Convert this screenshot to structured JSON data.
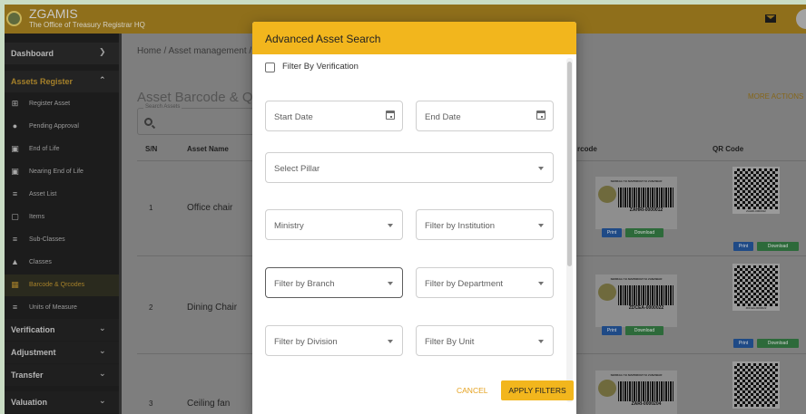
{
  "app": {
    "title": "ZGAMIS",
    "subtitle": "The Office of Treasury Registrar HQ"
  },
  "sidebar": {
    "dashboard": "Dashboard",
    "assets_register": "Assets Register",
    "items": [
      {
        "label": "Register Asset",
        "icon": "plus-box-icon"
      },
      {
        "label": "Pending Approval",
        "icon": "dots-circle-icon"
      },
      {
        "label": "End of Life",
        "icon": "calendar-icon"
      },
      {
        "label": "Nearing End of Life",
        "icon": "calendar-icon"
      },
      {
        "label": "Asset List",
        "icon": "list-icon"
      },
      {
        "label": "Items",
        "icon": "square-icon"
      },
      {
        "label": "Sub-Classes",
        "icon": "list-icon"
      },
      {
        "label": "Classes",
        "icon": "shapes-icon"
      },
      {
        "label": "Barcode & Qrcodes",
        "icon": "qr-icon"
      },
      {
        "label": "Units of Measure",
        "icon": "list-icon"
      }
    ],
    "verification": "Verification",
    "adjustment": "Adjustment",
    "transfer": "Transfer",
    "valuation": "Valuation"
  },
  "main": {
    "breadcrumb": "Home / Asset management /",
    "page_title": "Asset Barcode & QR",
    "more_actions": "MORE ACTIONS",
    "search_legend": "Search Assets",
    "columns": {
      "sn": "S/N",
      "name": "Asset Name",
      "barcode": "rcode",
      "qr": "QR Code"
    },
    "rows": [
      {
        "sn": "1",
        "name": "Office chair",
        "barcode_caption": "SERIKALI YA MAPINDUZI YA ZANZIBAR",
        "barcode_code": "ZAHRI-0000012",
        "qr_code": "ZAHRI-0000012"
      },
      {
        "sn": "2",
        "name": "Dining Chair",
        "barcode_caption": "SERIKALI YA MAPINDUZI YA ZANZIBAR",
        "barcode_code": "ZDCEA-0000022",
        "qr_code": "ZDCEA-0000022"
      },
      {
        "sn": "3",
        "name": "Ceiling fan",
        "barcode_caption": "SERIKALI YA MAPINDUZI YA ZANZIBAR",
        "barcode_code": "ZARI-0000204"
      }
    ],
    "print_label": "Print",
    "download_label": "Download"
  },
  "modal": {
    "title": "Advanced Asset Search",
    "filter_by_verification": "Filter By Verification",
    "start_date": "Start Date",
    "end_date": "End Date",
    "select_pillar": "Select Pillar",
    "ministry": "Ministry",
    "filter_by_institution": "Filter by Institution",
    "filter_by_branch": "Filter by Branch",
    "filter_by_department": "Filter by Department",
    "filter_by_division": "Filter by Division",
    "filter_by_unit": "Filter By Unit",
    "cancel": "CANCEL",
    "apply_filters": "APPLY FILTERS"
  },
  "colors": {
    "accent": "#f2b61d",
    "sidebar_bg": "#1c1c1c",
    "print": "#1f4a86",
    "download": "#2d6a3a"
  }
}
